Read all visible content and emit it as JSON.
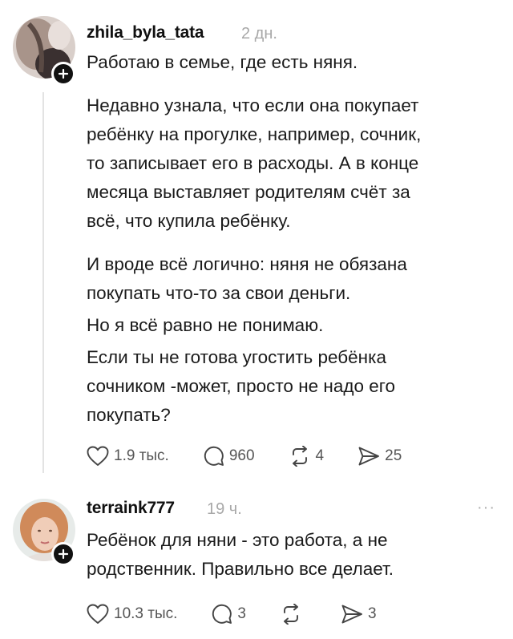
{
  "post1": {
    "username": "zhila_byla_tata",
    "time": "2 дн.",
    "paragraphs": [
      "Работаю в семье, где есть няня.",
      "Недавно узнала, что если она покупает",
      "ребёнку на прогулке, например, сочник,",
      "то записывает его в расходы. А в конце",
      "месяца выставляет родителям счёт за",
      "всё, что купила ребёнку.",
      "И вроде всё логично: няня не обязана",
      "покупать что-то за свои деньги.",
      "Но я всё равно не понимаю.",
      "Если ты не готова угостить ребёнка",
      "сочником -может, просто не надо его",
      "покупать?"
    ],
    "likes": "1.9 тыс.",
    "replies": "960",
    "reposts": "4",
    "shares": "25"
  },
  "post2": {
    "username": "terraink777",
    "time": "19 ч.",
    "more": "···",
    "paragraphs": [
      "Ребёнок для няни - это работа, а не",
      "родственник. Правильно все делает."
    ],
    "likes": "10.3 тыс.",
    "replies": "3",
    "reposts": "",
    "shares": "3"
  },
  "icons": [
    "heart-icon",
    "comment-icon",
    "repost-icon",
    "share-icon",
    "plus-icon"
  ]
}
